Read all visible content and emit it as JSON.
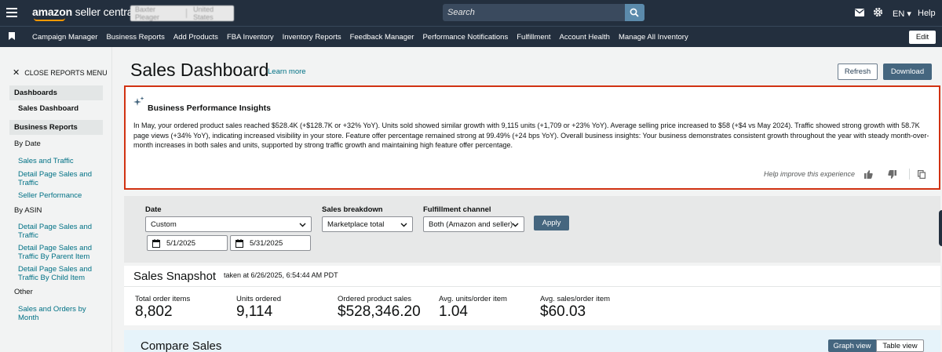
{
  "header": {
    "logo_prefix": "amazon",
    "logo_suffix": "seller central",
    "account_name": "Baxter Pleager",
    "account_region": "United States",
    "search_placeholder": "Search",
    "language": "EN",
    "help": "Help"
  },
  "nav": {
    "links": [
      "Campaign Manager",
      "Business Reports",
      "Add Products",
      "FBA Inventory",
      "Inventory Reports",
      "Feedback Manager",
      "Performance Notifications",
      "Fulfillment",
      "Account Health",
      "Manage All Inventory"
    ],
    "edit": "Edit"
  },
  "sidebar": {
    "close_menu": "CLOSE REPORTS MENU",
    "dashboards_heading": "Dashboards",
    "sales_dashboard": "Sales Dashboard",
    "business_reports_heading": "Business Reports",
    "by_date": "By Date",
    "sales_and_traffic": "Sales and Traffic",
    "detail_page_sales_traffic": "Detail Page Sales and Traffic",
    "seller_performance": "Seller Performance",
    "by_asin": "By ASIN",
    "asin_detail_page": "Detail Page Sales and Traffic",
    "asin_by_parent": "Detail Page Sales and Traffic By Parent Item",
    "asin_by_child": "Detail Page Sales and Traffic By Child Item",
    "other": "Other",
    "sales_orders_by_month": "Sales and Orders by Month"
  },
  "main": {
    "title": "Sales Dashboard",
    "learn_more": "Learn more",
    "refresh": "Refresh",
    "download": "Download"
  },
  "insights": {
    "title": "Business Performance Insights",
    "body": "In May, your ordered product sales reached $528.4K (+$128.7K or +32% YoY). Units sold showed similar growth with 9,115 units (+1,709 or +23% YoY). Average selling price increased to $58 (+$4 vs May 2024). Traffic showed strong growth with 58.7K page views (+34% YoY), indicating increased visibility in your store. Feature offer percentage remained strong at 99.49% (+24 bps YoY). Overall business insights: Your business demonstrates consistent growth throughout the year with steady month-over-month increases in both sales and units, supported by strong traffic growth and maintaining high feature offer percentage.",
    "help_text": "Help improve this experience"
  },
  "filters": {
    "date_label": "Date",
    "date_value": "Custom",
    "start_date": "5/1/2025",
    "end_date": "5/31/2025",
    "breakdown_label": "Sales breakdown",
    "breakdown_value": "Marketplace total",
    "channel_label": "Fulfillment channel",
    "channel_value": "Both (Amazon and seller)",
    "apply": "Apply"
  },
  "snapshot": {
    "title": "Sales Snapshot",
    "taken_at": "taken at 6/26/2025, 6:54:44 AM PDT",
    "metrics": [
      {
        "label": "Total order items",
        "value": "8,802"
      },
      {
        "label": "Units ordered",
        "value": "9,114"
      },
      {
        "label": "Ordered product sales",
        "value": "$528,346.20"
      },
      {
        "label": "Avg. units/order item",
        "value": "1.04"
      },
      {
        "label": "Avg. sales/order item",
        "value": "$60.03"
      }
    ]
  },
  "compare": {
    "title": "Compare Sales",
    "graph_view": "Graph view",
    "table_view": "Table view"
  },
  "colors": {
    "header_bg": "#232f3e",
    "primary_button": "#45667f",
    "link": "#007185",
    "highlight_border": "#d13212",
    "accent": "#ff9900"
  }
}
